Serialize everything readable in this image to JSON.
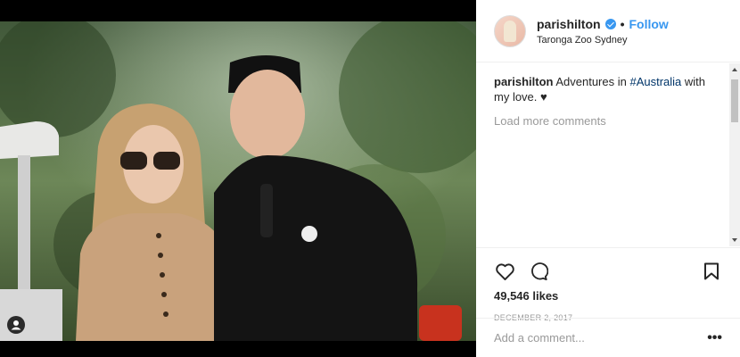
{
  "post": {
    "image_alt": "Paris Hilton and a man in a black cap and hoodie",
    "tag_icon": "user-tag-icon"
  },
  "header": {
    "username": "parishilton",
    "verified": true,
    "separator": "•",
    "follow_label": "Follow",
    "location": "Taronga Zoo Sydney",
    "accent_color": "#3897f0"
  },
  "caption": {
    "username": "parishilton",
    "text_before": "Adventures in ",
    "hashtag": "#Australia",
    "text_after": " with my love. ♥"
  },
  "comments": {
    "load_more_label": "Load more comments"
  },
  "actions": {
    "like_icon": "heart-icon",
    "comment_icon": "comment-icon",
    "save_icon": "bookmark-icon",
    "likes_text": "49,546 likes",
    "date": "DECEMBER 2, 2017"
  },
  "add_comment": {
    "placeholder": "Add a comment...",
    "more_label": "•••"
  }
}
